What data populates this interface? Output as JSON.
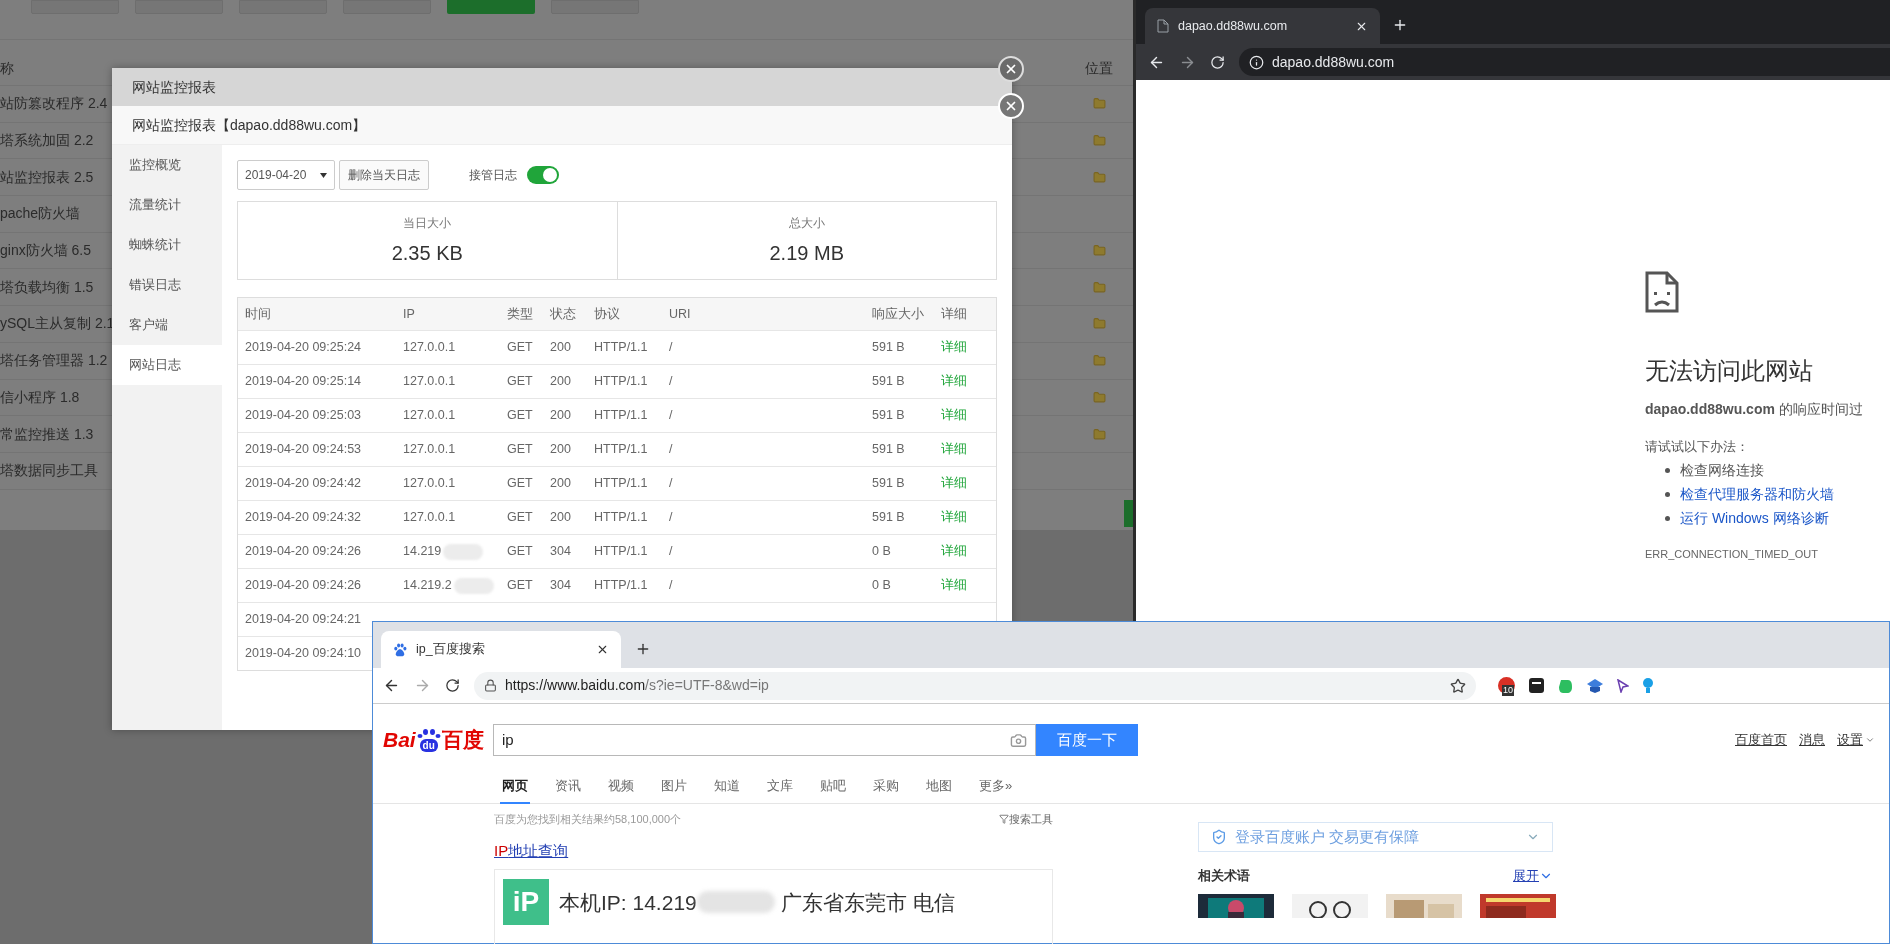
{
  "background_page": {
    "filter_buttons": [
      {
        "selected": false
      },
      {
        "selected": false
      },
      {
        "selected": false
      },
      {
        "selected": false
      },
      {
        "selected": true
      },
      {
        "selected": false
      }
    ],
    "header": {
      "name_column": "称",
      "location_column": "位置"
    },
    "rows": [
      {
        "name": "站防篡改程序 2.4",
        "folder": true
      },
      {
        "name": "塔系统加固 2.2",
        "folder": true
      },
      {
        "name": "站监控报表 2.5",
        "folder": true
      },
      {
        "name": "pache防火墙",
        "folder": false
      },
      {
        "name": "ginx防火墙 6.5",
        "folder": true
      },
      {
        "name": "塔负载均衡 1.5",
        "folder": true
      },
      {
        "name": "ySQL主从复制 2.1",
        "folder": true
      },
      {
        "name": "塔任务管理器 1.2",
        "folder": true
      },
      {
        "name": "信小程序 1.8",
        "folder": true
      },
      {
        "name": "常监控推送 1.3",
        "folder": true
      },
      {
        "name": "塔数据同步工具",
        "folder": false
      }
    ]
  },
  "modal_back": {
    "title": "网站监控报表"
  },
  "modal": {
    "title": "网站监控报表【dapao.dd88wu.com】",
    "sidebar": [
      {
        "label": "监控概览",
        "selected": false
      },
      {
        "label": "流量统计",
        "selected": false
      },
      {
        "label": "蜘蛛统计",
        "selected": false
      },
      {
        "label": "错误日志",
        "selected": false
      },
      {
        "label": "客户端",
        "selected": false
      },
      {
        "label": "网站日志",
        "selected": true
      }
    ],
    "date_select": "2019-04-20",
    "delete_button": "删除当天日志",
    "takeover": {
      "label": "接管日志",
      "on": true
    },
    "stats": [
      {
        "label": "当日大小",
        "value": "2.35 KB"
      },
      {
        "label": "总大小",
        "value": "2.19 MB"
      }
    ],
    "table": {
      "columns": [
        "时间",
        "IP",
        "类型",
        "状态",
        "协议",
        "URI",
        "响应大小",
        "详细"
      ],
      "rows": [
        {
          "time": "2019-04-20 09:25:24",
          "ip": "127.0.0.1",
          "method": "GET",
          "status": "200",
          "protocol": "HTTP/1.1",
          "uri": "/",
          "size": "591 B",
          "detail": "详细",
          "redacted": false
        },
        {
          "time": "2019-04-20 09:25:14",
          "ip": "127.0.0.1",
          "method": "GET",
          "status": "200",
          "protocol": "HTTP/1.1",
          "uri": "/",
          "size": "591 B",
          "detail": "详细",
          "redacted": false
        },
        {
          "time": "2019-04-20 09:25:03",
          "ip": "127.0.0.1",
          "method": "GET",
          "status": "200",
          "protocol": "HTTP/1.1",
          "uri": "/",
          "size": "591 B",
          "detail": "详细",
          "redacted": false
        },
        {
          "time": "2019-04-20 09:24:53",
          "ip": "127.0.0.1",
          "method": "GET",
          "status": "200",
          "protocol": "HTTP/1.1",
          "uri": "/",
          "size": "591 B",
          "detail": "详细",
          "redacted": false
        },
        {
          "time": "2019-04-20 09:24:42",
          "ip": "127.0.0.1",
          "method": "GET",
          "status": "200",
          "protocol": "HTTP/1.1",
          "uri": "/",
          "size": "591 B",
          "detail": "详细",
          "redacted": false
        },
        {
          "time": "2019-04-20 09:24:32",
          "ip": "127.0.0.1",
          "method": "GET",
          "status": "200",
          "protocol": "HTTP/1.1",
          "uri": "/",
          "size": "591 B",
          "detail": "详细",
          "redacted": false
        },
        {
          "time": "2019-04-20 09:24:26",
          "ip": "14.219",
          "method": "GET",
          "status": "304",
          "protocol": "HTTP/1.1",
          "uri": "/",
          "size": "0 B",
          "detail": "详细",
          "redacted": true
        },
        {
          "time": "2019-04-20 09:24:26",
          "ip": "14.219.2",
          "method": "GET",
          "status": "304",
          "protocol": "HTTP/1.1",
          "uri": "/",
          "size": "0 B",
          "detail": "详细",
          "redacted": true
        },
        {
          "time": "2019-04-20 09:24:21"
        },
        {
          "time": "2019-04-20 09:24:10"
        }
      ]
    }
  },
  "error_browser": {
    "tab_title": "dapao.dd88wu.com",
    "url": "dapao.dd88wu.com",
    "heading": "无法访问此网站",
    "message": "**dapao.dd88wu.com** 的响应时间过",
    "suggest_title": "请试试以下办法：",
    "suggestions": [
      {
        "text": "检查网络连接",
        "kind": "plain"
      },
      {
        "text": "检查代理服务器和防火墙",
        "kind": "link"
      },
      {
        "text": "运行 Windows 网络诊断",
        "kind": "link"
      }
    ],
    "error_code": "ERR_CONNECTION_TIMED_OUT"
  },
  "baidu_browser": {
    "tab_title": "ip_百度搜索",
    "url_host": "https://www.baidu.com",
    "url_path": "/s?ie=UTF-8&wd=ip",
    "extension_badge": "10",
    "logo": {
      "left": "Bai",
      "paw": "du",
      "right": "百度"
    },
    "search": {
      "value": "ip"
    },
    "search_button": "百度一下",
    "top_links": [
      "百度首页",
      "消息",
      "设置"
    ],
    "nav": [
      {
        "label": "网页",
        "selected": true
      },
      {
        "label": "资讯",
        "selected": false
      },
      {
        "label": "视频",
        "selected": false
      },
      {
        "label": "图片",
        "selected": false
      },
      {
        "label": "知道",
        "selected": false
      },
      {
        "label": "文库",
        "selected": false
      },
      {
        "label": "贴吧",
        "selected": false
      },
      {
        "label": "采购",
        "selected": false
      },
      {
        "label": "地图",
        "selected": false
      },
      {
        "label": "更多»",
        "selected": false
      }
    ],
    "result_count": "百度为您找到相关结果约58,100,000个",
    "tools": "搜索工具",
    "result_title": {
      "highlight": "IP",
      "rest": "地址查询"
    },
    "ip_card": {
      "icon": "iP",
      "prefix": "本机IP: 14.219",
      "location": "广东省东莞市 电信"
    },
    "login_banner": "登录百度账户 交易更有保障",
    "related": {
      "title": "相关术语",
      "expand": "展开"
    }
  }
}
